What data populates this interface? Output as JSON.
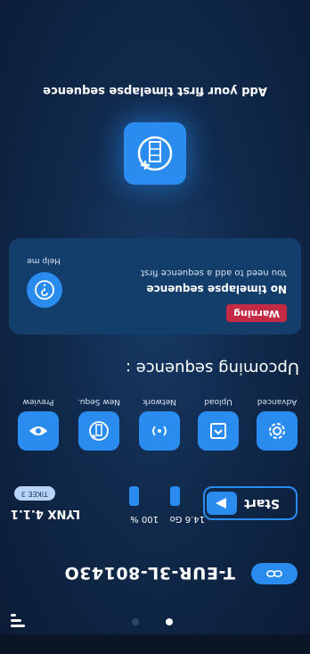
{
  "header": {
    "device_id": "T-EUR-3L-80143O"
  },
  "pager": {
    "pages": 2,
    "active": 1
  },
  "device": {
    "model": "LYNX 4.1.1",
    "badge": "TIKEE 3",
    "battery": "100 %",
    "storage": "14.6 Go",
    "start_label": "Start"
  },
  "quick_actions": [
    {
      "label": "Preview",
      "icon": "eye-icon"
    },
    {
      "label": "New Sequ.",
      "icon": "new-sequence-icon"
    },
    {
      "label": "Network",
      "icon": "network-icon"
    },
    {
      "label": "Upload",
      "icon": "upload-icon"
    },
    {
      "label": "Advanced",
      "icon": "gear-icon"
    }
  ],
  "upcoming": {
    "title": "Upcoming sequence :"
  },
  "warning": {
    "tag": "Warning",
    "title": "No timelapse sequence",
    "description": "You need to add a sequence first",
    "help_label": "Help me"
  },
  "add_sequence": {
    "title": "Add your first timelapse sequence"
  },
  "colors": {
    "accent": "#2b8cf0",
    "warning": "#c52a44",
    "background": "#0b1c35"
  }
}
